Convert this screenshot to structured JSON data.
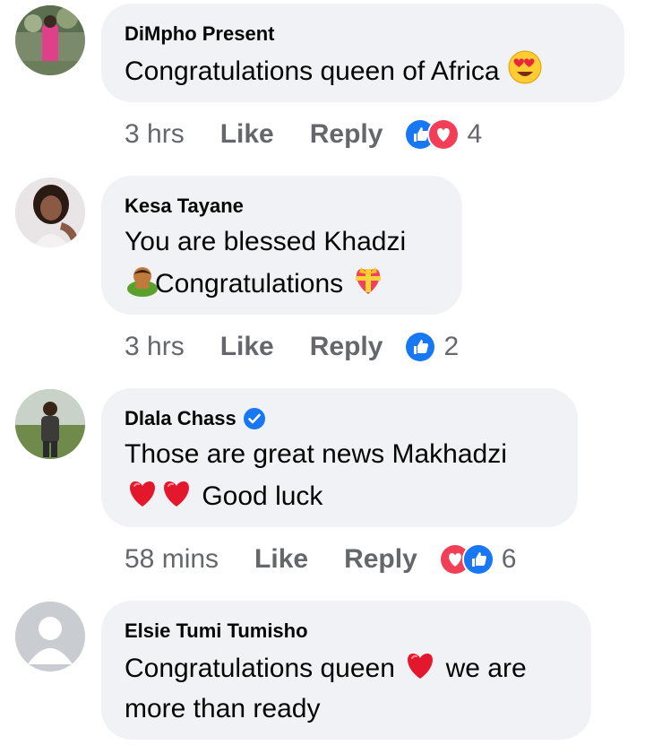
{
  "comments": [
    {
      "author": "DiMpho Present",
      "text_lines": [
        "Congratulations queen of Africa"
      ],
      "time": "3 hrs",
      "like_label": "Like",
      "reply_label": "Reply",
      "reactions": [
        "like",
        "love"
      ],
      "reaction_count": "4"
    },
    {
      "author": "Kesa Tayane",
      "text_lines": [
        "You are blessed Khadzi",
        "Congratulations"
      ],
      "time": "3 hrs",
      "like_label": "Like",
      "reply_label": "Reply",
      "reactions": [
        "like"
      ],
      "reaction_count": "2"
    },
    {
      "author": "Dlala Chass",
      "verified": true,
      "text_lines": [
        "Those are great news Makhadzi",
        "Good luck"
      ],
      "time": "58 mins",
      "like_label": "Like",
      "reply_label": "Reply",
      "reactions": [
        "love",
        "like"
      ],
      "reaction_count": "6"
    },
    {
      "author": "Elsie Tumi Tumisho",
      "text_lines": [
        "Congratulations queen",
        "we are",
        "more than ready"
      ]
    }
  ],
  "colors": {
    "bubble": "#f0f2f5",
    "meta_text": "#65676b",
    "like_blue": "#1877f2",
    "love_red": "#f33e58"
  }
}
